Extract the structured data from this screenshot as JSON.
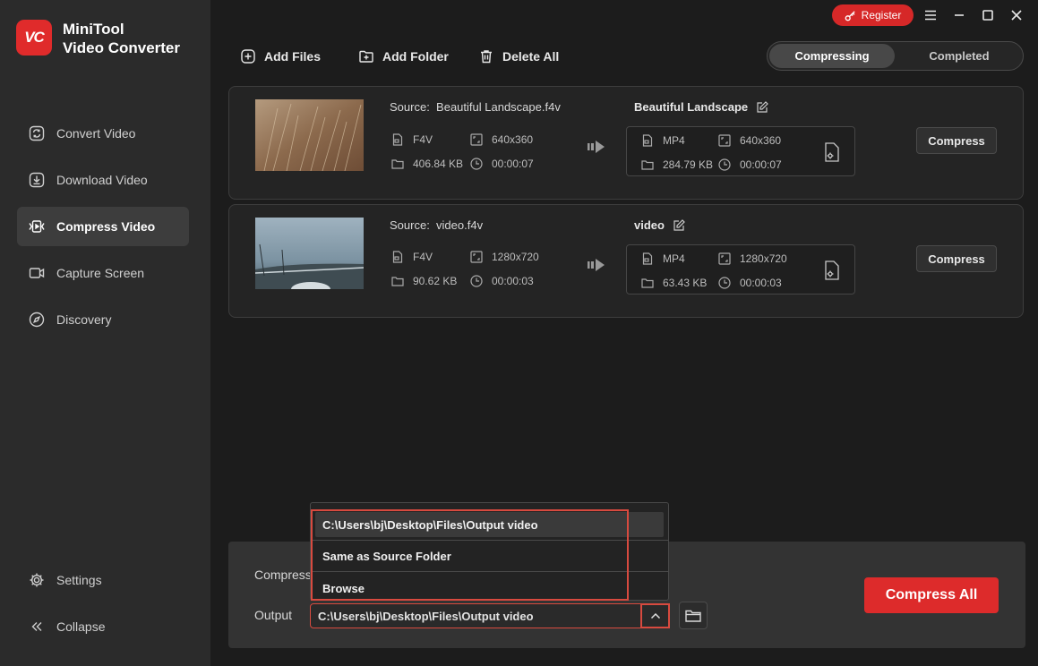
{
  "app": {
    "logo_text": "VC",
    "title_line1": "MiniTool",
    "title_line2": "Video Converter"
  },
  "sidebar": {
    "items": [
      {
        "label": "Convert Video",
        "icon": "convert-icon",
        "active": false
      },
      {
        "label": "Download Video",
        "icon": "download-icon",
        "active": false
      },
      {
        "label": "Compress Video",
        "icon": "compress-icon",
        "active": true
      },
      {
        "label": "Capture Screen",
        "icon": "camera-icon",
        "active": false
      },
      {
        "label": "Discovery",
        "icon": "compass-icon",
        "active": false
      }
    ],
    "bottom": [
      {
        "label": "Settings",
        "icon": "gear-icon"
      },
      {
        "label": "Collapse",
        "icon": "collapse-icon"
      }
    ]
  },
  "toolbar": {
    "add_files": "Add Files",
    "add_folder": "Add Folder",
    "delete_all": "Delete All"
  },
  "header": {
    "register": "Register"
  },
  "tabs": [
    {
      "label": "Compressing",
      "active": true
    },
    {
      "label": "Completed",
      "active": false
    }
  ],
  "files": [
    {
      "source_label": "Source:",
      "source_name": "Beautiful Landscape.f4v",
      "src_format": "F4V",
      "src_resolution": "640x360",
      "src_size": "406.84 KB",
      "src_duration": "00:00:07",
      "output_name": "Beautiful Landscape",
      "out_format": "MP4",
      "out_resolution": "640x360",
      "out_size": "284.79 KB",
      "out_duration": "00:00:07",
      "button": "Compress"
    },
    {
      "source_label": "Source:",
      "source_name": "video.f4v",
      "src_format": "F4V",
      "src_resolution": "1280x720",
      "src_size": "90.62 KB",
      "src_duration": "00:00:03",
      "output_name": "video",
      "out_format": "MP4",
      "out_resolution": "1280x720",
      "out_size": "63.43 KB",
      "out_duration": "00:00:03",
      "button": "Compress"
    }
  ],
  "bottom": {
    "compress_label": "Compress",
    "output_label": "Output",
    "output_path": "C:\\Users\\bj\\Desktop\\Files\\Output video",
    "compress_all": "Compress All"
  },
  "dropdown": {
    "options": [
      {
        "label": "C:\\Users\\bj\\Desktop\\Files\\Output video",
        "selected": true
      },
      {
        "label": "Same as Source Folder",
        "selected": false
      },
      {
        "label": "Browse",
        "selected": false
      }
    ]
  },
  "colors": {
    "accent": "#dd2b2b",
    "highlight": "#d84a3f",
    "sidebar_bg": "#2b2b2b",
    "main_bg": "#1c1c1c"
  }
}
